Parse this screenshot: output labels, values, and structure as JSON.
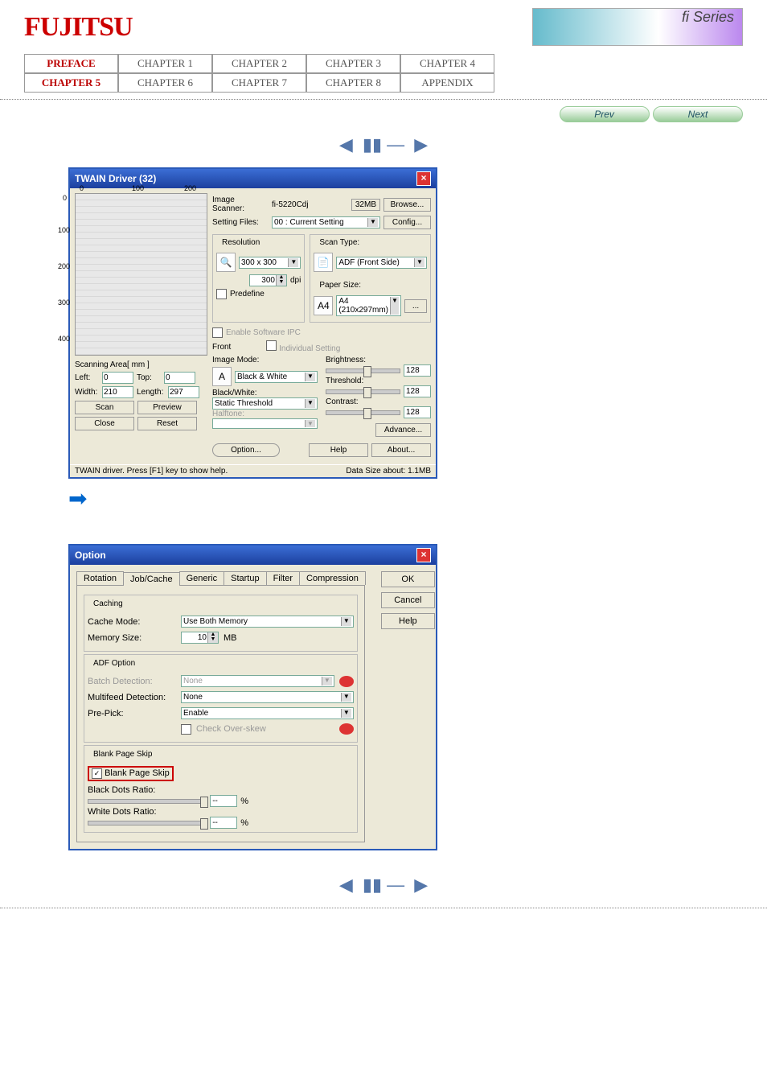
{
  "header": {
    "logo": "FUJITSU",
    "banner": "fi Series"
  },
  "nav": {
    "row1": [
      "PREFACE",
      "CHAPTER 1",
      "CHAPTER 2",
      "CHAPTER 3",
      "CHAPTER 4"
    ],
    "row2": [
      "CHAPTER 5",
      "CHAPTER 6",
      "CHAPTER 7",
      "CHAPTER 8",
      "APPENDIX"
    ]
  },
  "prevnext": {
    "prev": "Prev",
    "next": "Next"
  },
  "twain": {
    "title": "TWAIN Driver (32)",
    "ruler_marks": [
      "0",
      "100",
      "200"
    ],
    "ruler_side": [
      "0",
      "100",
      "200",
      "300",
      "400"
    ],
    "scanning_area_label": "Scanning Area[ mm ]",
    "left_label": "Left:",
    "left_val": "0",
    "top_label": "Top:",
    "top_val": "0",
    "width_label": "Width:",
    "width_val": "210",
    "length_label": "Length:",
    "length_val": "297",
    "btn_scan": "Scan",
    "btn_preview": "Preview",
    "btn_close": "Close",
    "btn_reset": "Reset",
    "image_scanner_label": "Image Scanner:",
    "image_scanner_val": "fi-5220Cdj",
    "mem": "32MB",
    "browse": "Browse...",
    "setting_files_label": "Setting Files:",
    "setting_files_val": "00 : Current Setting",
    "config": "Config...",
    "resolution_label": "Resolution",
    "resolution_val": "300 x 300",
    "dpi_val": "300",
    "dpi_unit": "dpi",
    "predefine": "Predefine",
    "enable_ipc": "Enable Software IPC",
    "front": "Front",
    "scan_type_label": "Scan Type:",
    "scan_type_val": "ADF (Front Side)",
    "paper_size_label": "Paper Size:",
    "paper_size_val": "A4 (210x297mm)",
    "individual": "Individual Setting",
    "image_mode_label": "Image Mode:",
    "image_mode_val": "Black & White",
    "bw_label": "Black/White:",
    "bw_val": "Static Threshold",
    "halftone_label": "Halftone:",
    "brightness_label": "Brightness:",
    "brightness_val": "128",
    "threshold_label": "Threshold:",
    "threshold_val": "128",
    "contrast_label": "Contrast:",
    "contrast_val": "128",
    "advance": "Advance...",
    "option": "Option...",
    "help": "Help",
    "about": "About...",
    "status_left": "TWAIN driver. Press [F1] key to show help.",
    "status_right_label": "Data Size about:",
    "status_right_val": "1.1MB"
  },
  "option": {
    "title": "Option",
    "tabs": [
      "Rotation",
      "Job/Cache",
      "Generic",
      "Startup",
      "Filter",
      "Compression"
    ],
    "caching": "Caching",
    "cache_mode_label": "Cache Mode:",
    "cache_mode_val": "Use Both Memory",
    "memory_size_label": "Memory Size:",
    "memory_size_val": "10",
    "memory_size_unit": "MB",
    "adf_option": "ADF Option",
    "batch_label": "Batch Detection:",
    "batch_val": "None",
    "multifeed_label": "Multifeed Detection:",
    "multifeed_val": "None",
    "prepick_label": "Pre-Pick:",
    "prepick_val": "Enable",
    "overskew": "Check Over-skew",
    "blank_section": "Blank Page Skip",
    "blank_chk": "Blank Page Skip",
    "black_ratio": "Black Dots Ratio:",
    "black_val": "--",
    "pct": "%",
    "white_ratio": "White Dots Ratio:",
    "white_val": "--",
    "ok": "OK",
    "cancel": "Cancel",
    "helpbtn": "Help"
  }
}
